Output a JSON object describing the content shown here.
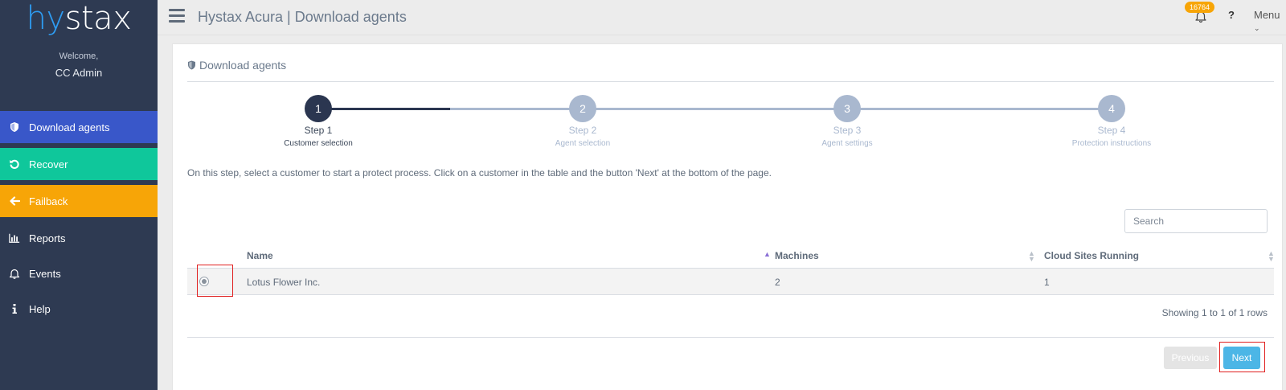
{
  "sidebar": {
    "logo_part1": "hy",
    "logo_part2": "stax",
    "welcome": "Welcome,",
    "user": "CC Admin",
    "items": [
      {
        "label": "Download agents"
      },
      {
        "label": "Recover"
      },
      {
        "label": "Failback"
      },
      {
        "label": "Reports"
      },
      {
        "label": "Events"
      },
      {
        "label": "Help"
      }
    ],
    "colors": {
      "bg": "#2e3a52",
      "download": "#3957c9",
      "recover": "#0fc79b",
      "failback": "#f7a507"
    }
  },
  "topbar": {
    "title": "Hystax Acura | Download agents",
    "notification_count": "16764",
    "help": "?",
    "menu": "Menu"
  },
  "panel": {
    "title": "Download agents"
  },
  "stepper": {
    "active_index": 0,
    "steps": [
      {
        "number": "1",
        "label": "Step 1",
        "sub": "Customer selection"
      },
      {
        "number": "2",
        "label": "Step 2",
        "sub": "Agent selection"
      },
      {
        "number": "3",
        "label": "Step 3",
        "sub": "Agent settings"
      },
      {
        "number": "4",
        "label": "Step 4",
        "sub": "Protection instructions"
      }
    ],
    "colors": {
      "active": "#2b3650",
      "inactive": "#a9b8cf"
    }
  },
  "instruction": "On this step, select a customer to start a protect process. Click on a customer in the table and the button 'Next' at the bottom of the page.",
  "search": {
    "placeholder": "Search"
  },
  "table": {
    "headers": {
      "name": "Name",
      "machines": "Machines",
      "cloud_sites": "Cloud Sites Running"
    },
    "sort_column": "name",
    "rows": [
      {
        "selected": true,
        "name": "Lotus Flower Inc.",
        "machines": "2",
        "cloud_sites": "1"
      }
    ],
    "summary": "Showing 1 to 1 of 1 rows"
  },
  "buttons": {
    "previous": "Previous",
    "next": "Next"
  }
}
